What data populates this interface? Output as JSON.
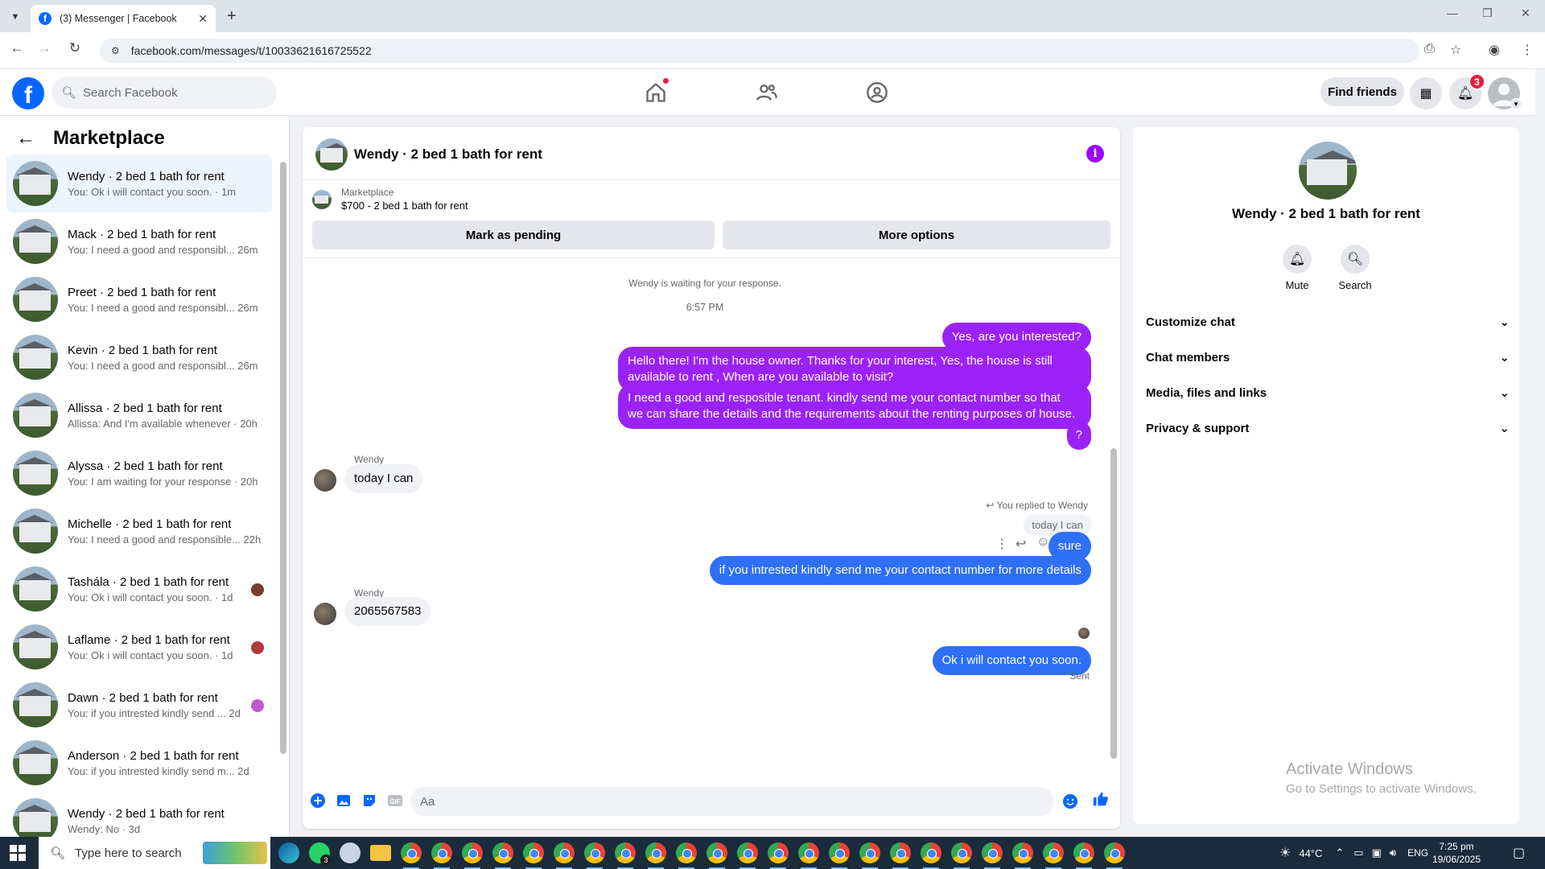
{
  "browser": {
    "tab_title": "(3) Messenger | Facebook",
    "url": "facebook.com/messages/t/10033621616725522",
    "new_tab": "+",
    "tab_close": "✕"
  },
  "fb": {
    "logo": "f",
    "search_placeholder": "Search Facebook",
    "find_friends": "Find friends",
    "notifications_count": "3"
  },
  "sidebar": {
    "title": "Marketplace",
    "conversations": [
      {
        "name": "Wendy · 2 bed 1 bath for rent",
        "preview": "You: Ok i will contact you soon. · 1m",
        "active": true
      },
      {
        "name": "Mack · 2 bed 1 bath for rent",
        "preview": "You: I need a good and responsibl...   26m"
      },
      {
        "name": "Preet · 2 bed 1 bath for rent",
        "preview": "You: I need a good and responsibl...   26m"
      },
      {
        "name": "Kevin · 2 bed 1 bath for rent",
        "preview": "You: I need a good and responsibl...   26m"
      },
      {
        "name": "Allissa · 2 bed 1 bath for rent",
        "preview": "Allissa: And I'm available whenever · 20h"
      },
      {
        "name": "Alyssa · 2 bed 1 bath for rent",
        "preview": "You: I am waiting for your response · 20h"
      },
      {
        "name": "Michelle · 2 bed 1 bath for rent",
        "preview": "You: I need a good and responsible...   22h"
      },
      {
        "name": "Tashála · 2 bed 1 bath for rent",
        "preview": "You: Ok i will contact you soon. · 1d"
      },
      {
        "name": "Laflame · 2 bed 1 bath for rent",
        "preview": "You: Ok i will contact you soon. · 1d"
      },
      {
        "name": "Dawn · 2 bed 1 bath for rent",
        "preview": "You: if you intrested kindly send ...   2d"
      },
      {
        "name": "Anderson · 2 bed 1 bath for rent",
        "preview": "You: if you intrested kindly send m...   2d"
      },
      {
        "name": "Wendy · 2 bed 1 bath for rent",
        "preview": "Wendy: No · 3d"
      }
    ]
  },
  "chat": {
    "title": "Wendy · 2 bed 1 bath for rent",
    "info_icon": "i",
    "marketplace_label": "Marketplace",
    "listing": "$700 - 2 bed 1 bath for rent",
    "mark_pending": "Mark as pending",
    "more_options": "More options",
    "waiting": "Wendy is waiting for your response.",
    "time": "6:57 PM",
    "msg1": "Yes, are you interested?",
    "msg2_l1": "Hello there! I'm the house owner. Thanks for your interest, Yes, the house is still",
    "msg2_l2": "available to rent , When are you available to visit?",
    "msg3_l1": "I need a good and resposible tenant.  kindly send me your contact number so that",
    "msg3_l2": "we can share the details and the requirements about the renting purposes of house.",
    "msg4": "?",
    "sender1": "Wendy",
    "msg5": "today I can",
    "reply_note": "You replied to Wendy",
    "reply_quote": "today I can",
    "msg6": "sure",
    "msg7": "if you intrested kindly send me your contact number for more details",
    "sender2": "Wendy",
    "msg8": "2065567583",
    "msg9": "Ok i will contact you soon.",
    "sent": "Sent",
    "composer_placeholder": "Aa"
  },
  "right": {
    "name": "Wendy · 2 bed 1 bath for rent",
    "mute": "Mute",
    "search": "Search",
    "rows": [
      "Customize chat",
      "Chat members",
      "Media, files and links",
      "Privacy & support"
    ],
    "watermark_title": "Activate Windows",
    "watermark_sub": "Go to Settings to activate Windows."
  },
  "taskbar": {
    "search_placeholder": "Type here to search",
    "whatsapp_badge": "3",
    "temperature": "44°C",
    "language": "ENG",
    "time": "7:25 pm",
    "date": "19/06/2025"
  },
  "colors": {
    "fb_blue": "#0866ff",
    "bubble_purple": "#9b22f5",
    "bubble_blue": "#2e6ff5",
    "badge_red": "#e41e3f"
  }
}
